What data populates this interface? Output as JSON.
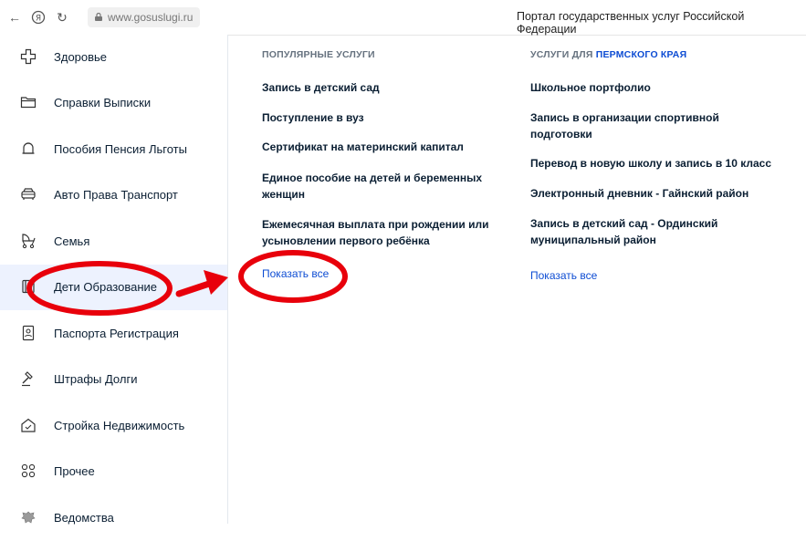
{
  "browser": {
    "url": "www.gosuslugi.ru",
    "page_title": "Портал государственных услуг Российской Федерации"
  },
  "sidebar": {
    "items": [
      {
        "label": "Здоровье",
        "icon": "health-cross-icon"
      },
      {
        "label": "Справки Выписки",
        "icon": "folder-icon"
      },
      {
        "label": "Пособия Пенсия Льготы",
        "icon": "bell-icon"
      },
      {
        "label": "Авто Права Транспорт",
        "icon": "car-icon"
      },
      {
        "label": "Семья",
        "icon": "stroller-icon"
      },
      {
        "label": "Дети Образование",
        "icon": "book-icon",
        "active": true
      },
      {
        "label": "Паспорта Регистрация",
        "icon": "passport-icon"
      },
      {
        "label": "Штрафы Долги",
        "icon": "gavel-icon"
      },
      {
        "label": "Стройка Недвижимость",
        "icon": "house-icon"
      },
      {
        "label": "Прочее",
        "icon": "grid-icon"
      },
      {
        "label": "Ведомства",
        "icon": "emblem-icon"
      }
    ]
  },
  "popular": {
    "heading": "ПОПУЛЯРНЫЕ УСЛУГИ",
    "services": [
      {
        "line1": "Запись в детский сад",
        "line2": ""
      },
      {
        "line1": "Поступление в вуз",
        "line2": ""
      },
      {
        "line1": "Сертификат на материнский капитал",
        "line2": ""
      },
      {
        "line1": "Единое пособие на детей и беременных",
        "line2": "женщин"
      },
      {
        "line1": "Ежемесячная выплата при рождении или",
        "line2": "усыновлении первого ребёнка"
      }
    ],
    "show_all": "Показать все"
  },
  "regional": {
    "heading_prefix": "УСЛУГИ ДЛЯ",
    "heading_region": "ПЕРМСКОГО КРАЯ",
    "services": [
      {
        "line1": "Школьное портфолио",
        "line2": ""
      },
      {
        "line1": "Запись в организации спортивной",
        "line2": "подготовки"
      },
      {
        "line1": "Перевод в новую школу и запись в 10 класс",
        "line2": ""
      },
      {
        "line1": "Электронный дневник - Гайнский район",
        "line2": ""
      },
      {
        "line1": "Запись в детский сад - Ординский",
        "line2": "муниципальный район"
      }
    ],
    "show_all": "Показать все"
  },
  "colors": {
    "accent": "#0d4cd3",
    "text": "#0b1f33",
    "active_bg": "#edf2fe",
    "annotation": "#e8000b"
  }
}
